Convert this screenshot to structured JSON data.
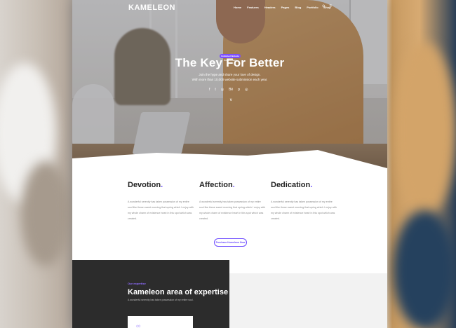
{
  "brand": {
    "logo_text": "KAMELEON"
  },
  "nav": {
    "links": [
      "Home",
      "Features",
      "Headers",
      "Pages",
      "Blog",
      "Portfolio",
      "Shop"
    ],
    "search_icon": "search-icon",
    "menu_icon": "menu-icon"
  },
  "hero": {
    "badge": "Unlimited Website Possibilities",
    "title": "The Key For Better",
    "subtitle_line1": "Join the hype and share your love of design.",
    "subtitle_line2": "With more than 10,000 website submission each year.",
    "social": [
      "f",
      "t",
      "◎",
      "Bē",
      "p",
      "◎"
    ],
    "scroll_glyph": "∨"
  },
  "features": [
    {
      "title": "Devotion",
      "dot": ".",
      "text": "A wonderful serenity has taken possession of my entire soul like these sweet morning that spring which I enjoy with my whole charm of existence heart in this spot which was created."
    },
    {
      "title": "Affection",
      "dot": ".",
      "text": "A wonderful serenity has taken possession of my entire soul like these sweet morning that spring which I enjoy with my whole charm of existence heart in this spot which was created."
    },
    {
      "title": "Dedication",
      "dot": ".",
      "text": "A wonderful serenity has taken possession of my entire soul like these sweet morning that spring which I enjoy with my whole charm of existence heart in this spot which was created."
    }
  ],
  "cta": {
    "purchase_label": "Purchase Kameleon Now"
  },
  "expertise": {
    "kicker": "Our expertise",
    "title": "Kameleon area of expertise",
    "subtitle": "A wonderful serenity has taken possession of my entire soul."
  },
  "colors": {
    "accent": "#6c4bff",
    "dark_section": "#2c2c2c"
  }
}
